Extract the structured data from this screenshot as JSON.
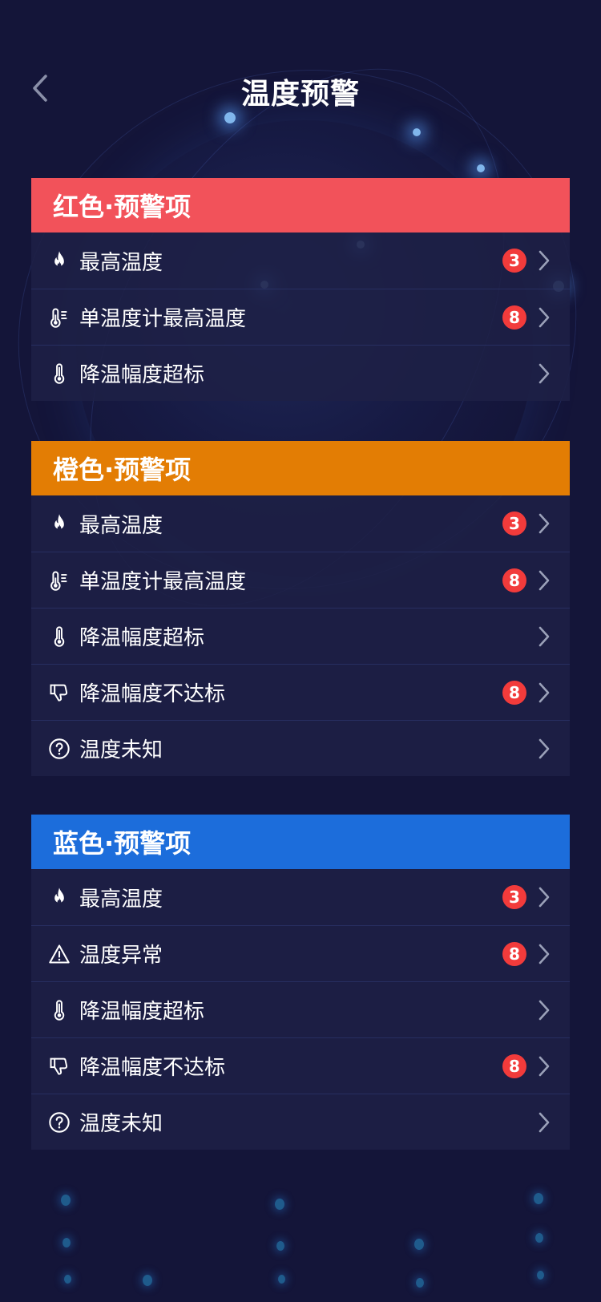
{
  "header": {
    "title": "温度预警"
  },
  "colors": {
    "red": "#f2525a",
    "orange": "#e37d04",
    "blue": "#1c6ddb",
    "badge": "#f23b3b"
  },
  "sections": [
    {
      "title": "红色·预警项",
      "color": "#f2525a",
      "items": [
        {
          "icon": "fire-icon",
          "label": "最高温度",
          "badge": "3"
        },
        {
          "icon": "thermometer-scale-icon",
          "label": "单温度计最高温度",
          "badge": "8"
        },
        {
          "icon": "thermometer-icon",
          "label": "降温幅度超标",
          "badge": ""
        }
      ]
    },
    {
      "title": "橙色·预警项",
      "color": "#e37d04",
      "items": [
        {
          "icon": "fire-icon",
          "label": "最高温度",
          "badge": "3"
        },
        {
          "icon": "thermometer-scale-icon",
          "label": "单温度计最高温度",
          "badge": "8"
        },
        {
          "icon": "thermometer-icon",
          "label": "降温幅度超标",
          "badge": ""
        },
        {
          "icon": "thumbs-down-icon",
          "label": "降温幅度不达标",
          "badge": "8"
        },
        {
          "icon": "question-circle-icon",
          "label": "温度未知",
          "badge": ""
        }
      ]
    },
    {
      "title": "蓝色·预警项",
      "color": "#1c6ddb",
      "items": [
        {
          "icon": "fire-icon",
          "label": "最高温度",
          "badge": "3"
        },
        {
          "icon": "warning-triangle-icon",
          "label": "温度异常",
          "badge": "8"
        },
        {
          "icon": "thermometer-icon",
          "label": "降温幅度超标",
          "badge": ""
        },
        {
          "icon": "thumbs-down-icon",
          "label": "降温幅度不达标",
          "badge": "8"
        },
        {
          "icon": "question-circle-icon",
          "label": "温度未知",
          "badge": ""
        }
      ]
    }
  ]
}
